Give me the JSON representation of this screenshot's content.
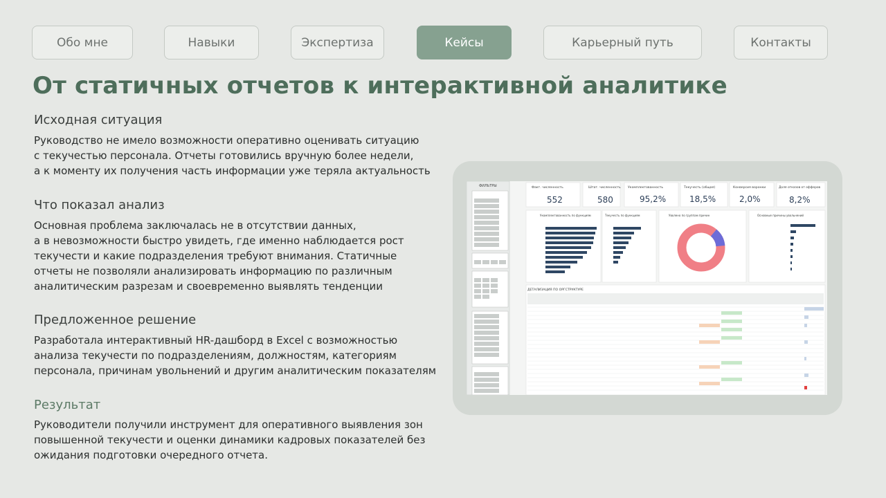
{
  "nav": {
    "tabs": [
      {
        "label": "Обо мне"
      },
      {
        "label": "Навыки"
      },
      {
        "label": "Экспертиза"
      },
      {
        "label": "Кейсы",
        "active": true
      },
      {
        "label": "Карьерный путь"
      },
      {
        "label": "Контакты"
      }
    ]
  },
  "title": "От статичных отчетов к интерактивной аналитике",
  "sections": [
    {
      "heading": "Исходная ситуация",
      "lines": [
        "Руководство не имело возможности оперативно оценивать ситуацию",
        "с текучестью персонала. Отчеты готовились вручную более недели,",
        "а к моменту их получения часть информации уже теряла актуальность"
      ]
    },
    {
      "heading": "Что показал анализ",
      "lines": [
        "Основная проблема заключалась не в отсутствии данных,",
        "а в невозможности быстро увидеть, где именно наблюдается рост",
        "текучести и какие подразделения требуют внимания. Статичные",
        "отчеты не позволяли анализировать информацию по различным",
        "аналитическим разрезам и своевременно выявлять тенденции"
      ]
    },
    {
      "heading": "Предложенное решение",
      "lines": [
        "Разработала интерактивный HR-дашборд в Excel с возможностью",
        "анализа текучести по подразделениям, должностям, категориям",
        "персонала, причинам увольнений и другим аналитическим показателям"
      ]
    },
    {
      "heading": "Результат",
      "lines": [
        "Руководители получили инструмент для оперативного выявления зон",
        "повышенной текучести и оценки динамики кадровых показателей без",
        "ожидания подготовки очередного отчета."
      ]
    }
  ],
  "dashboard": {
    "filters_title": "ФИЛЬТРЫ",
    "kpis": [
      {
        "label": "Факт. численность",
        "value": "552"
      },
      {
        "label": "Штат. численность",
        "value": "580"
      },
      {
        "label": "Укомплектованность",
        "value": "95,2%"
      },
      {
        "label": "Текучесть (общая)",
        "value": "18,5%"
      },
      {
        "label": "Конверсия воронки",
        "value": "2,0%"
      },
      {
        "label": "Доля отказов от офферов",
        "value": "8,2%"
      }
    ],
    "panel_titles": [
      "Укомплектованность по функциям",
      "Текучесть по функциям",
      "Уволено по группам причин",
      "Основные причины увольнений"
    ],
    "table_title": "ДЕТАЛИЗАЦИЯ ПО ОРГСТРУКТУРЕ",
    "colors": {
      "bar": "#2f4764",
      "donut_main": "#f07f86",
      "donut_alt": "#6c6cd8"
    }
  }
}
